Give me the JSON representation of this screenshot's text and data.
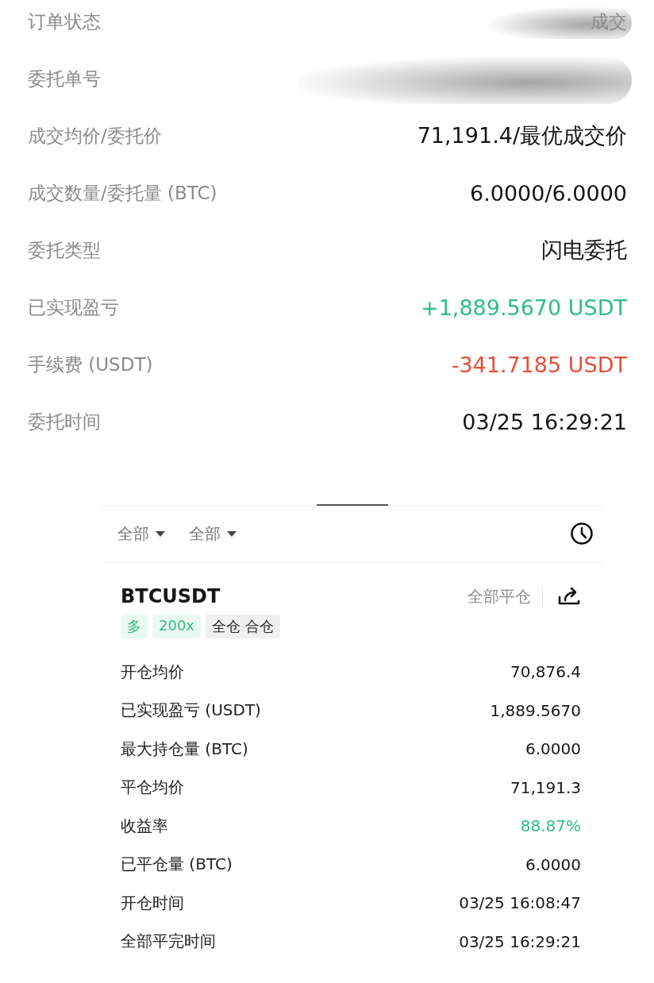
{
  "order_fields": [
    {
      "label": "订单状态",
      "value": "成交",
      "color": "#8a8a8a",
      "redacted": true
    },
    {
      "label": "委托单号",
      "redacted": true
    },
    {
      "label": "成交均价/委托价",
      "value": "71,191.4/最优成交价",
      "color": "#161616"
    },
    {
      "label": "成交数量/委托量 (BTC)",
      "value": "6.0000/6.0000",
      "color": "#161616"
    },
    {
      "label": "委托类型",
      "value": "闪电委托",
      "color": "#161616"
    },
    {
      "label": "已实现盈亏",
      "value": "+1,889.5670 USDT",
      "color": "#2ebd85"
    },
    {
      "label": "手续费 (USDT)",
      "value": "-341.7185 USDT",
      "color": "#e5503b"
    },
    {
      "label": "委托时间",
      "value": "03/25 16:29:21",
      "color": "#161616"
    }
  ],
  "filters": [
    {
      "label": "全部"
    },
    {
      "label": "全部"
    }
  ],
  "position": {
    "symbol": "BTCUSDT",
    "action": "全部平仓",
    "tags": [
      {
        "label": "多",
        "kind": "accent"
      },
      {
        "label": "200x",
        "kind": "accent"
      },
      {
        "label": "全仓 合仓",
        "kind": "neutral"
      }
    ],
    "details": [
      {
        "label": "开仓均价",
        "value": "70,876.4",
        "color": "#161616"
      },
      {
        "label": "已实现盈亏 (USDT)",
        "value": "1,889.5670",
        "color": "#161616"
      },
      {
        "label": "最大持仓量 (BTC)",
        "value": "6.0000",
        "color": "#161616"
      },
      {
        "label": "平仓均价",
        "value": "71,191.3",
        "color": "#161616"
      },
      {
        "label": "收益率",
        "value": "88.87%",
        "color": "#2ebd85"
      },
      {
        "label": "已平仓量 (BTC)",
        "value": "6.0000",
        "color": "#161616"
      },
      {
        "label": "开仓时间",
        "value": "03/25 16:08:47",
        "color": "#161616"
      },
      {
        "label": "全部平完时间",
        "value": "03/25 16:29:21",
        "color": "#161616"
      }
    ]
  }
}
